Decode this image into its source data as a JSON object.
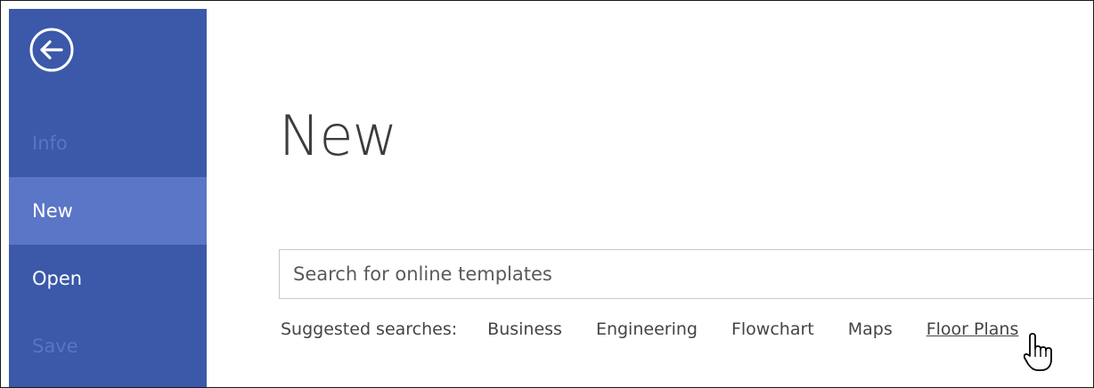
{
  "sidebar": {
    "back_icon": "back-arrow-circle-icon",
    "items": [
      {
        "label": "Info",
        "state": "disabled"
      },
      {
        "label": "New",
        "state": "selected"
      },
      {
        "label": "Open",
        "state": "normal"
      },
      {
        "label": "Save",
        "state": "disabled"
      }
    ]
  },
  "main": {
    "title": "New",
    "search": {
      "placeholder": "Search for online templates"
    },
    "suggested": {
      "label": "Suggested searches:",
      "links": [
        "Business",
        "Engineering",
        "Flowchart",
        "Maps",
        "Floor Plans"
      ],
      "hovered": "Floor Plans"
    }
  },
  "cursor": "hand-pointer-icon",
  "colors": {
    "sidebar": "#3b58a9",
    "sidebar_selected": "#5b76c6",
    "sidebar_disabled_text": "#5a75c0",
    "title_text": "#3c3c3c"
  }
}
